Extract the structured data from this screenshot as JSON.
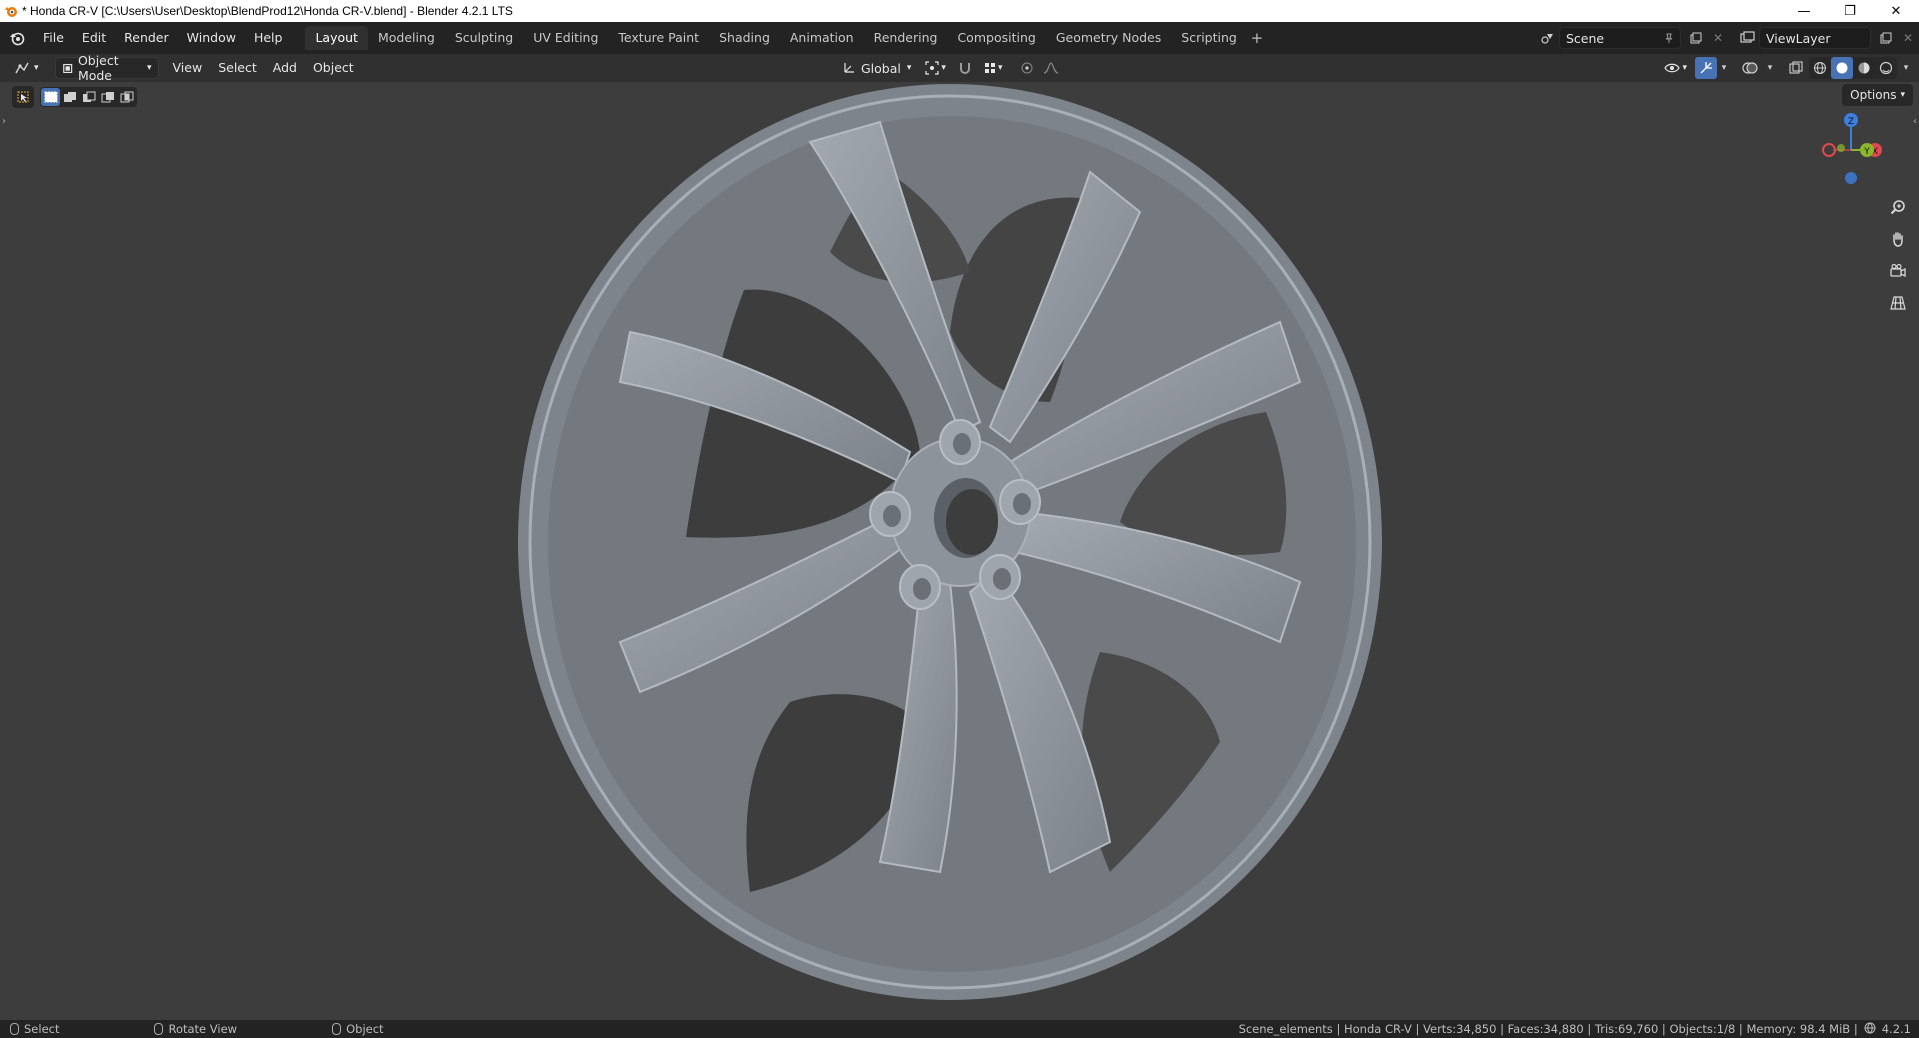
{
  "window": {
    "title": "* Honda CR-V [C:\\Users\\User\\Desktop\\BlendProd12\\Honda CR-V.blend] - Blender 4.2.1 LTS",
    "minimize_glyph": "—",
    "restore_glyph": "❐",
    "close_glyph": "✕"
  },
  "topbar": {
    "menus": [
      "File",
      "Edit",
      "Render",
      "Window",
      "Help"
    ],
    "workspaces": [
      "Layout",
      "Modeling",
      "Sculpting",
      "UV Editing",
      "Texture Paint",
      "Shading",
      "Animation",
      "Rendering",
      "Compositing",
      "Geometry Nodes",
      "Scripting"
    ],
    "active_workspace": "Layout",
    "add_workspace": "+",
    "scene": "Scene",
    "view_layer": "ViewLayer"
  },
  "viewport_header": {
    "mode": "Object Mode",
    "menus": [
      "View",
      "Select",
      "Add",
      "Object"
    ],
    "transform_orientation": "Global"
  },
  "viewport": {
    "options_label": "Options",
    "gizmo_axes": [
      "Z",
      "X",
      "Y"
    ],
    "colors": {
      "x_axis": "#e0474e",
      "y_axis": "#8bb72c",
      "z_axis": "#3c7fe0",
      "background": "#3d3d3d",
      "accent": "#4772b3"
    },
    "nav_icons": [
      "zoom-icon",
      "pan-hand-icon",
      "camera-icon",
      "grid-perspective-icon"
    ]
  },
  "statusbar": {
    "hints": [
      "Select",
      "Rotate View",
      "Object"
    ],
    "stats": "Scene_elements | Honda CR-V | Verts:34,850 | Faces:34,880 | Tris:69,760 | Objects:1/8 | Memory: 98.4 MiB |",
    "version": "4.2.1"
  }
}
